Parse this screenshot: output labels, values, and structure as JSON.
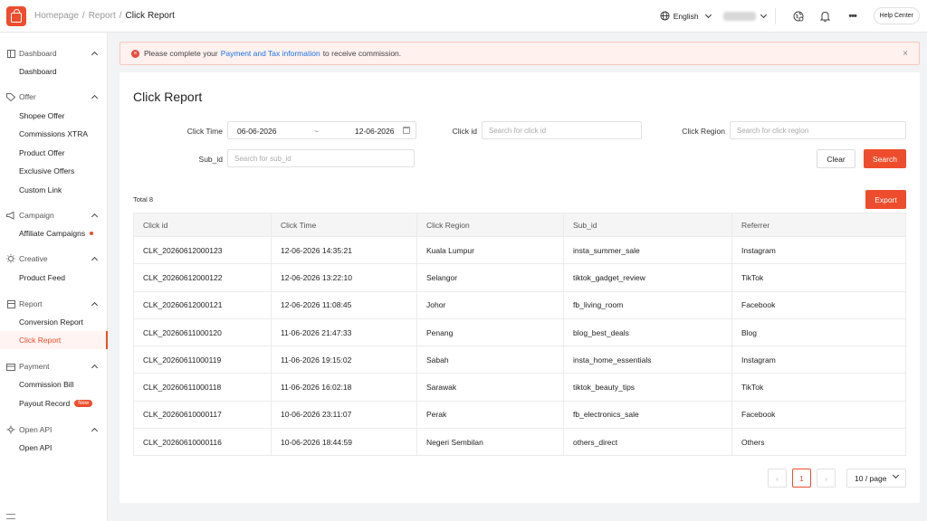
{
  "header": {
    "breadcrumb": [
      "Homepage",
      "/",
      "Report",
      "/",
      "Click Report"
    ],
    "language": "English",
    "help": "Help Center",
    "icons": [
      "shopee-logo-icon",
      "globe-icon",
      "settings-globe-icon",
      "bell-icon",
      "more-icon"
    ]
  },
  "sidebar": {
    "sections": [
      {
        "title": "Dashboard",
        "icon": "dashboard-icon",
        "items": [
          {
            "label": "Dashboard"
          }
        ]
      },
      {
        "title": "Offer",
        "icon": "tag-icon",
        "items": [
          {
            "label": "Shopee Offer"
          },
          {
            "label": "Commissions XTRA"
          },
          {
            "label": "Product Offer"
          },
          {
            "label": "Exclusive Offers"
          },
          {
            "label": "Custom Link"
          }
        ]
      },
      {
        "title": "Campaign",
        "icon": "megaphone-icon",
        "items": [
          {
            "label": "Affiliate Campaigns"
          }
        ]
      },
      {
        "title": "Creative",
        "icon": "bulb-icon",
        "items": [
          {
            "label": "Product Feed"
          }
        ]
      },
      {
        "title": "Report",
        "icon": "report-icon",
        "items": [
          {
            "label": "Conversion Report"
          },
          {
            "label": "Click Report"
          }
        ]
      },
      {
        "title": "Payment",
        "icon": "wallet-icon",
        "items": [
          {
            "label": "Commission Bill"
          },
          {
            "label": "Payout Record"
          }
        ]
      },
      {
        "title": "Open API",
        "icon": "api-icon",
        "items": [
          {
            "label": "Open API"
          }
        ]
      }
    ],
    "new_badge": "New",
    "active": "Click Report"
  },
  "alert": {
    "before": "Please complete your",
    "link": "Payment and Tax information",
    "after": "to receive commission.",
    "icon": "error-circle-icon",
    "close": "×"
  },
  "page": {
    "title": "Click Report",
    "filters": {
      "click_time_label": "Click Time",
      "date_start": "06-06-2026",
      "date_sep": "~",
      "date_end": "12-06-2026",
      "click_id_label": "Click id",
      "click_id_placeholder": "Search for click id",
      "click_region_label": "Click Region",
      "click_region_placeholder": "Search for click region",
      "sub_id_label": "Sub_id",
      "sub_id_placeholder": "Search for sub_id"
    },
    "buttons": {
      "clear": "Clear",
      "search": "Search",
      "export": "Export"
    },
    "total": "Total 8",
    "table": {
      "columns": [
        "Click id",
        "Click Time",
        "Click Region",
        "Sub_id",
        "Referrer"
      ],
      "rows": [
        [
          "CLK_20260612000123",
          "12-06-2026 14:35:21",
          "Kuala Lumpur",
          "insta_summer_sale",
          "Instagram"
        ],
        [
          "CLK_20260612000122",
          "12-06-2026 13:22:10",
          "Selangor",
          "tiktok_gadget_review",
          "TikTok"
        ],
        [
          "CLK_20260612000121",
          "12-06-2026 11:08:45",
          "Johor",
          "fb_living_room",
          "Facebook"
        ],
        [
          "CLK_20260611000120",
          "11-06-2026 21:47:33",
          "Penang",
          "blog_best_deals",
          "Blog"
        ],
        [
          "CLK_20260611000119",
          "11-06-2026 19:15:02",
          "Sabah",
          "insta_home_essentials",
          "Instagram"
        ],
        [
          "CLK_20260611000118",
          "11-06-2026 16:02:18",
          "Sarawak",
          "tiktok_beauty_tips",
          "TikTok"
        ],
        [
          "CLK_20260610000117",
          "10-06-2026 23:11:07",
          "Perak",
          "fb_electronics_sale",
          "Facebook"
        ],
        [
          "CLK_20260610000116",
          "10-06-2026 18:44:59",
          "Negeri Sembilan",
          "others_direct",
          "Others"
        ]
      ]
    },
    "pagination": {
      "prev": "‹",
      "current": "1",
      "next": "›",
      "page_size": "10 / page"
    }
  },
  "colors": {
    "accent": "#ee4d2d",
    "link": "#1a73e8",
    "alert_bg": "#fff1ee"
  }
}
